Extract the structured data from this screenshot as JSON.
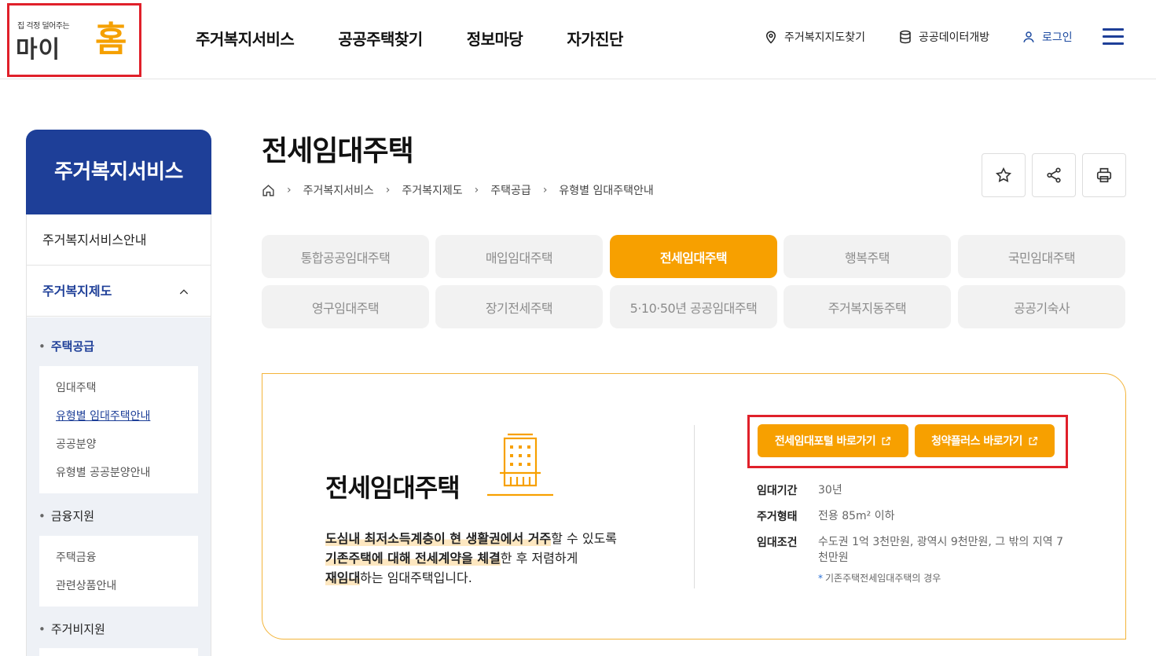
{
  "header": {
    "logo_tagline": "집 걱정 덜어주는",
    "logo_main": "마이",
    "logo_home": "홈",
    "gnb": [
      "주거복지서비스",
      "공공주택찾기",
      "정보마당",
      "자가진단"
    ],
    "util": {
      "map": "주거복지지도찾기",
      "data": "공공데이터개방",
      "login": "로그인"
    }
  },
  "sidebar": {
    "title": "주거복지서비스",
    "items": [
      {
        "label": "주거복지서비스안내"
      },
      {
        "label": "주거복지제도"
      }
    ],
    "groups": [
      {
        "title": "주택공급",
        "links": [
          "임대주택",
          "유형별 임대주택안내",
          "공공분양",
          "유형별 공공분양안내"
        ]
      },
      {
        "title": "금융지원",
        "links": [
          "주택금융",
          "관련상품안내"
        ]
      },
      {
        "title": "주거비지원",
        "links": []
      }
    ]
  },
  "page": {
    "title": "전세임대주택",
    "breadcrumb": [
      "주거복지서비스",
      "주거복지제도",
      "주택공급",
      "유형별 임대주택안내"
    ]
  },
  "tabs": [
    "통합공공임대주택",
    "매입임대주택",
    "전세임대주택",
    "행복주택",
    "국민임대주택",
    "영구임대주택",
    "장기전세주택",
    "5·10·50년 공공임대주택",
    "주거복지동주택",
    "공공기숙사"
  ],
  "active_tab": "전세임대주택",
  "card": {
    "title": "전세임대주택",
    "desc": {
      "p1_hl": "도심내 최저소득계층이 현 생활권에서 거주",
      "p1_rest": "할 수 있도록",
      "p2_hl": "기존주택에 대해 전세계약을 체결",
      "p2_rest": "한 후 저렴하게",
      "p3_hl": "재임대",
      "p3_rest": "하는 임대주택입니다."
    },
    "buttons": [
      "전세임대포털 바로가기",
      "청약플러스 바로가기"
    ],
    "info": [
      {
        "k": "임대기간",
        "v": "30년"
      },
      {
        "k": "주거형태",
        "v": "전용 85m² 이하"
      },
      {
        "k": "임대조건",
        "v": "수도권 1억 3천만원, 광역시 9천만원, 그 밖의 지역 7천만원"
      }
    ],
    "note": "기존주택전세임대주택의 경우"
  },
  "colors": {
    "brand_blue": "#1e3f98",
    "accent_orange": "#f7a000",
    "highlight_red": "#e0202a"
  }
}
